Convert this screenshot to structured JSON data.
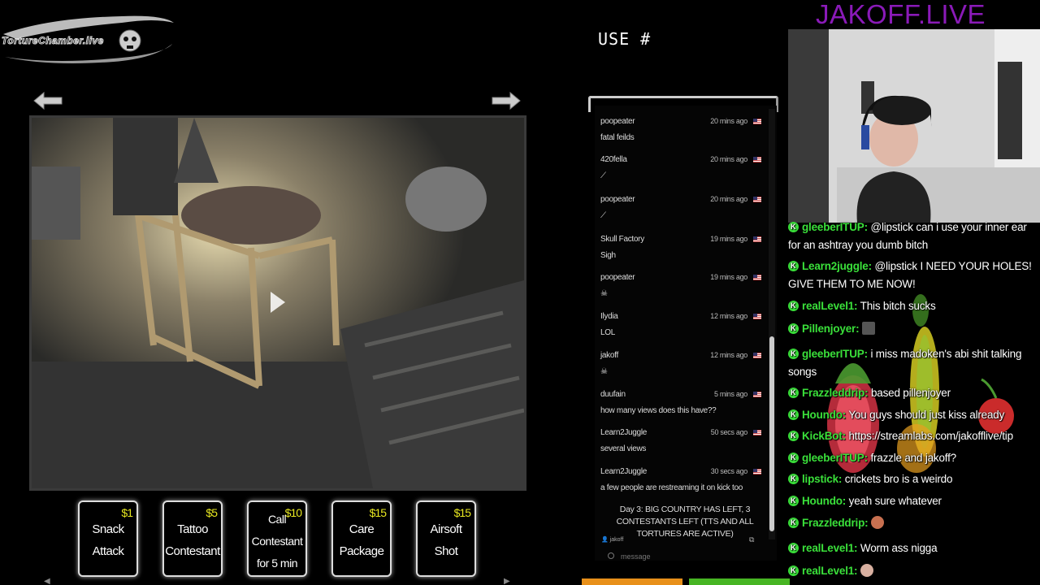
{
  "logo": {
    "text": "TortureChamber.live"
  },
  "header": {
    "use_label": "USE #",
    "site_title": "JAKOFF.LIVE"
  },
  "tip_buttons": [
    {
      "price": "$1",
      "label_lines": [
        "Snack",
        "Attack"
      ]
    },
    {
      "price": "$5",
      "label_lines": [
        "Tattoo",
        "Contestant"
      ]
    },
    {
      "price": "$10",
      "label_lines": [
        "Call",
        "Contestant",
        "for 5 min"
      ]
    },
    {
      "price": "$15",
      "label_lines": [
        "Care",
        "Package"
      ]
    },
    {
      "price": "$15",
      "label_lines": [
        "Airsoft",
        "Shot"
      ]
    }
  ],
  "chat_widget": {
    "messages": [
      {
        "user": "poopeater",
        "time": "20 mins ago",
        "text": "fatal feilds"
      },
      {
        "user": "420fella",
        "time": "20 mins ago",
        "text": "",
        "emote": "needle"
      },
      {
        "user": "poopeater",
        "time": "20 mins ago",
        "text": "",
        "emote": "needle"
      },
      {
        "user": "Skull Factory",
        "time": "19 mins ago",
        "text": "Sigh"
      },
      {
        "user": "poopeater",
        "time": "19 mins ago",
        "text": "",
        "emote": "skull"
      },
      {
        "user": "Ilydia",
        "time": "12 mins ago",
        "text": "LOL"
      },
      {
        "user": "jakoff",
        "time": "12 mins ago",
        "text": "",
        "emote": "skull"
      },
      {
        "user": "duufain",
        "time": "5 mins ago",
        "text": "how many views does this have??"
      },
      {
        "user": "Learn2Juggle",
        "time": "50 secs ago",
        "text": "several views"
      },
      {
        "user": "Learn2Juggle",
        "time": "30 secs ago",
        "text": "a few people are restreaming it on kick too"
      }
    ],
    "announcement": "Day 3: BIG COUNTRY HAS LEFT, 3 CONTESTANTS LEFT (TTS AND ALL TORTURES ARE ACTIVE)",
    "footer_user": "jakoff",
    "input_placeholder": "message"
  },
  "kick_chat": [
    {
      "user": "gleeberITUP:",
      "text": "@lipstick can i use your inner ear for an ashtray you dumb bitch"
    },
    {
      "user": "Learn2juggle:",
      "text": "@lipstick I NEED YOUR HOLES! GIVE THEM TO ME NOW!"
    },
    {
      "user": "realLevel1:",
      "text": "This bitch sucks"
    },
    {
      "user": "Pillenjoyer:",
      "text": "",
      "emote": "figure"
    },
    {
      "user": "gleeberITUP:",
      "text": "i miss madoken's abi shit talking songs"
    },
    {
      "user": "Frazzleddrip:",
      "text": "based pillenjoyer"
    },
    {
      "user": "Houndo:",
      "text": "You guys should just kiss already"
    },
    {
      "user": "KickBot:",
      "text": "https://streamlabs.com/jakofflive/tip"
    },
    {
      "user": "gleeberITUP:",
      "text": "frazzle and jakoff?"
    },
    {
      "user": "lipstick:",
      "text": "crickets bro is a weirdo"
    },
    {
      "user": "Houndo:",
      "text": "yeah sure whatever"
    },
    {
      "user": "Frazzleddrip:",
      "text": "",
      "emote": "face"
    },
    {
      "user": "realLevel1:",
      "text": "Worm ass nigga"
    },
    {
      "user": "realLevel1:",
      "text": "",
      "emote": "face"
    }
  ],
  "colors": {
    "price": "#e8e820",
    "kick_green": "#3ae03a",
    "site_title": "#8a1ab8",
    "bar_orange": "#e8901a",
    "bar_green": "#47b523"
  }
}
